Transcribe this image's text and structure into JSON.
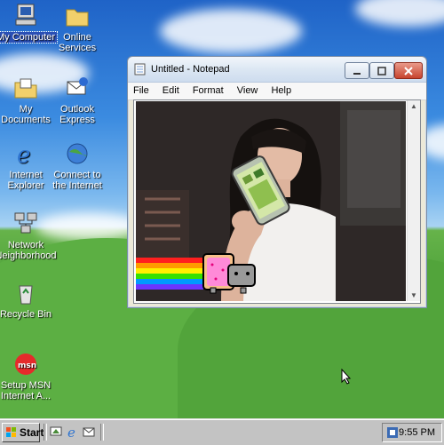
{
  "desktop": {
    "icons": [
      {
        "label": "My Computer"
      },
      {
        "label": "Online Services"
      },
      {
        "label": "My Documents"
      },
      {
        "label": "Outlook Express"
      },
      {
        "label": "Internet Explorer"
      },
      {
        "label": "Connect to the Internet"
      },
      {
        "label": "Network Neighborhood"
      },
      {
        "label": "Recycle Bin"
      },
      {
        "label": "Setup MSN Internet A..."
      }
    ]
  },
  "notepad": {
    "title": "Untitled - Notepad",
    "menu": [
      "File",
      "Edit",
      "Format",
      "View",
      "Help"
    ]
  },
  "taskbar": {
    "start_label": "Start",
    "clock": "9:55 PM"
  },
  "colors": {
    "selection": "#2a4fb5",
    "taskbar": "#c3c3c3"
  }
}
